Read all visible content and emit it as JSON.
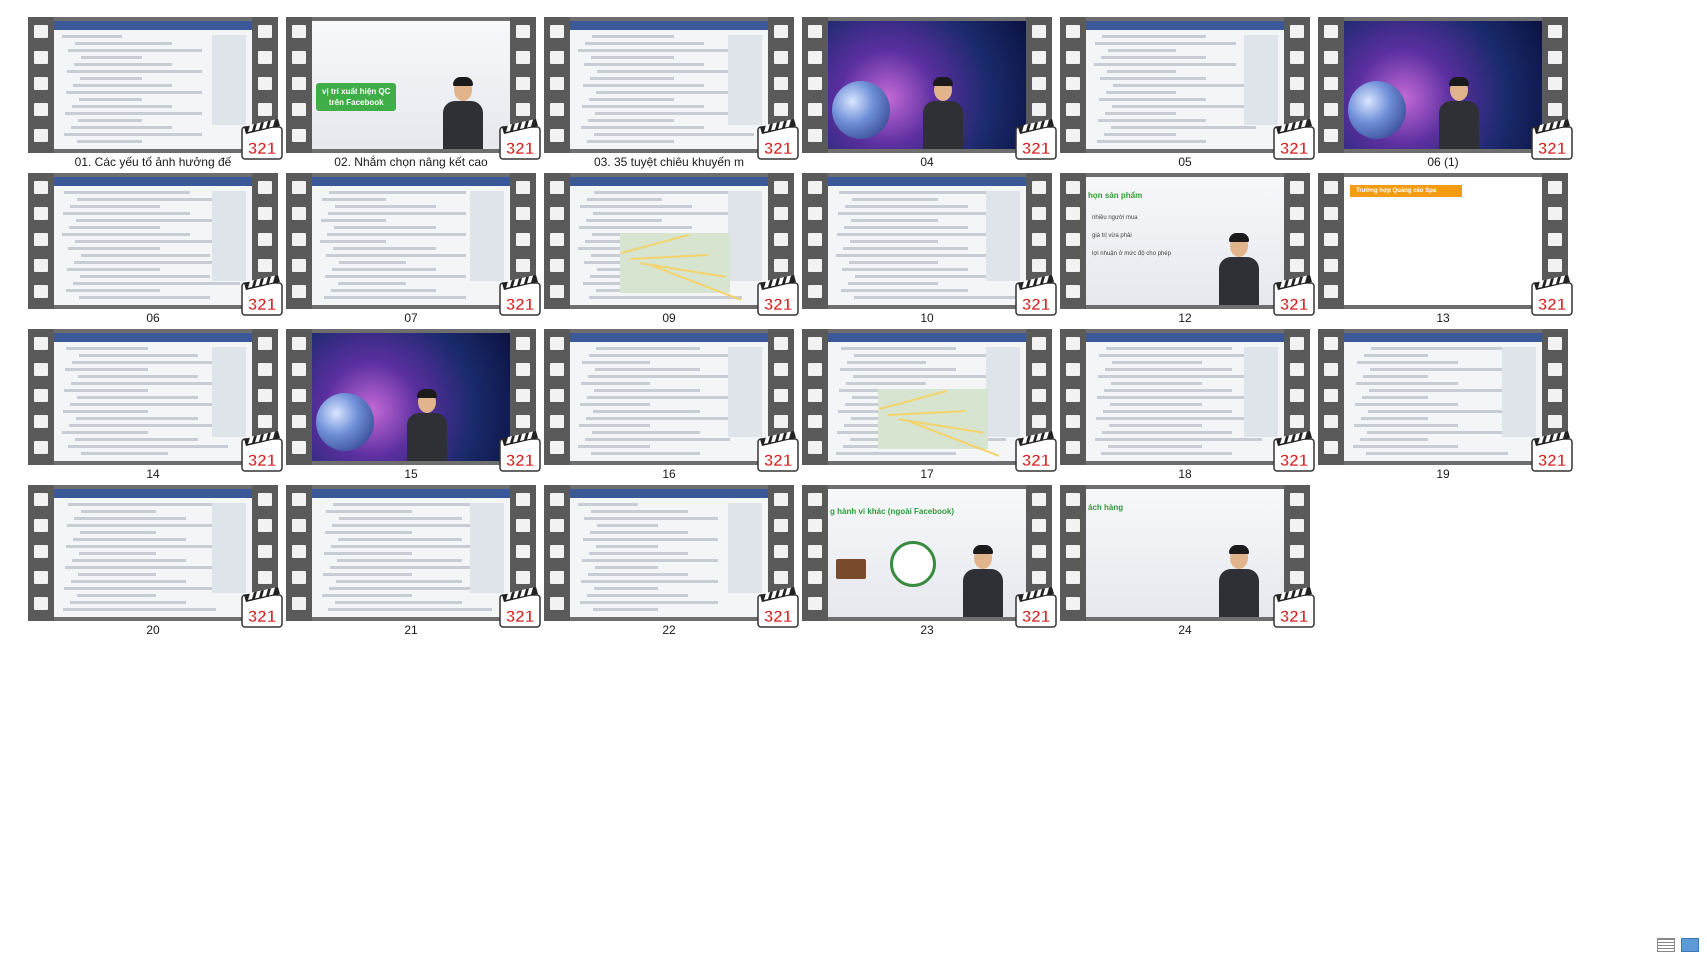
{
  "window": {
    "view": "Large icons"
  },
  "colors": {
    "background": "#ffffff",
    "film": "#5a5a5a",
    "badge_red": "#d62828",
    "green": "#3fae48",
    "orange": "#f39c12"
  },
  "badge_icon": "media-player-classic-321-icon",
  "badge_text": "321",
  "files": [
    {
      "label": "01. Các yếu tố ảnh hưởng đế",
      "kind": "web"
    },
    {
      "label": "02. Nhắm chọn nâng kết cao",
      "kind": "slide-badge",
      "slide_text": [
        "vị trí xuất hiện QC",
        "trên Facebook"
      ]
    },
    {
      "label": "03. 35 tuyệt chiêu khuyến m",
      "kind": "web"
    },
    {
      "label": "04",
      "kind": "studio"
    },
    {
      "label": "05",
      "kind": "web"
    },
    {
      "label": "06 (1)",
      "kind": "studio"
    },
    {
      "label": "06",
      "kind": "web"
    },
    {
      "label": "07",
      "kind": "web"
    },
    {
      "label": "09",
      "kind": "web-map"
    },
    {
      "label": "10",
      "kind": "web"
    },
    {
      "label": "12",
      "kind": "slide-person",
      "slide_title": "họn sản phẩm",
      "slide_lines": [
        "nhiều người mua",
        "giá trị vừa phải",
        "lợi nhuận ở mức độ cho phép"
      ]
    },
    {
      "label": "13",
      "kind": "slide-orange",
      "slide_title": "Trường hợp Quảng cáo Spa"
    },
    {
      "label": "14",
      "kind": "web"
    },
    {
      "label": "15",
      "kind": "studio"
    },
    {
      "label": "16",
      "kind": "web"
    },
    {
      "label": "17",
      "kind": "web-map"
    },
    {
      "label": "18",
      "kind": "web"
    },
    {
      "label": "19",
      "kind": "web"
    },
    {
      "label": "20",
      "kind": "web"
    },
    {
      "label": "21",
      "kind": "web"
    },
    {
      "label": "22",
      "kind": "web"
    },
    {
      "label": "23",
      "kind": "slide-clock",
      "slide_title": "g hành vi khác (ngoài Facebook)"
    },
    {
      "label": "24",
      "kind": "slide-person",
      "slide_title": "ách hàng",
      "slide_lines": []
    }
  ],
  "status_bar": {
    "icons": [
      "details-view-icon",
      "large-icons-view-icon"
    ]
  }
}
